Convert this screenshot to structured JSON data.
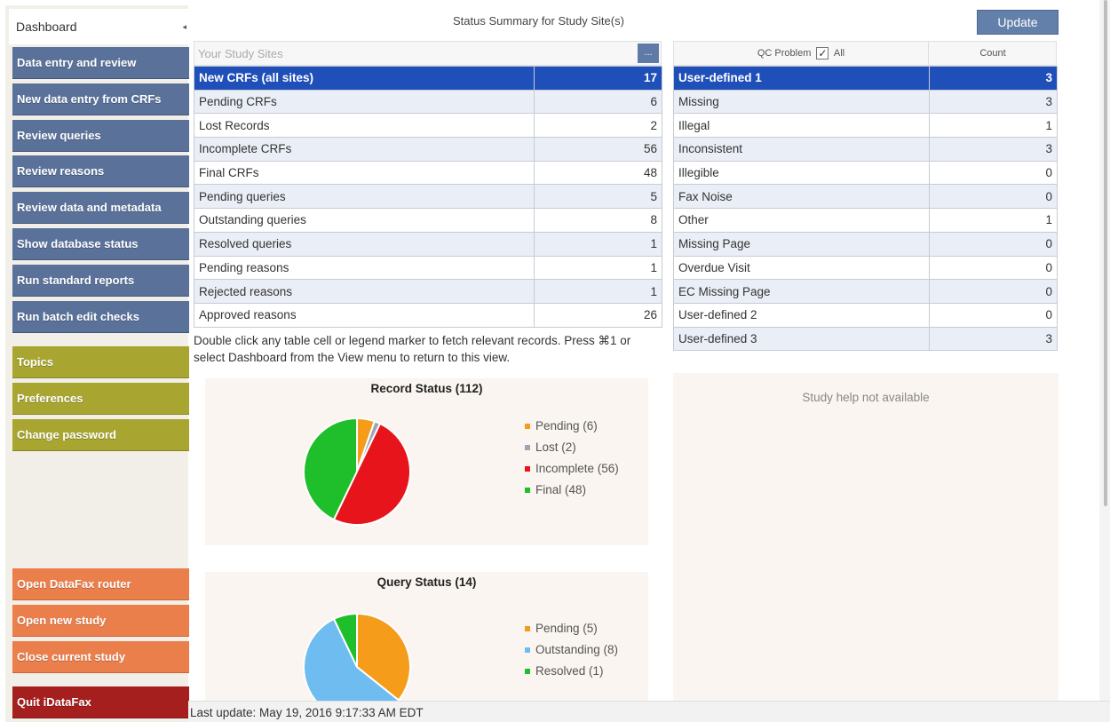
{
  "sidebar": {
    "tab_label": "Dashboard",
    "tab_arrow": "◂",
    "buttons_blue": [
      "Data entry and review",
      "New data entry from CRFs",
      "Review  queries",
      "Review reasons",
      "Review data and metadata",
      "Show database status",
      "Run standard reports",
      "Run batch edit checks"
    ],
    "buttons_olive": [
      "Topics",
      "Preferences",
      "Change password"
    ],
    "buttons_orange": [
      "Open DataFax router",
      "Open new study",
      "Close current study"
    ],
    "quit_label": "Quit iDataFax"
  },
  "header": {
    "title": "Status Summary for Study Site(s)",
    "update_label": "Update"
  },
  "sites": {
    "placeholder": "Your Study Sites",
    "more_label": "...",
    "rows": [
      {
        "label": "New CRFs (all sites)",
        "value": "17"
      },
      {
        "label": "Pending CRFs",
        "value": "6"
      },
      {
        "label": "Lost Records",
        "value": "2"
      },
      {
        "label": "Incomplete CRFs",
        "value": "56"
      },
      {
        "label": "Final CRFs",
        "value": "48"
      },
      {
        "label": "Pending queries",
        "value": "5"
      },
      {
        "label": "Outstanding queries",
        "value": "8"
      },
      {
        "label": "Resolved queries",
        "value": "1"
      },
      {
        "label": "Pending reasons",
        "value": "1"
      },
      {
        "label": "Rejected reasons",
        "value": "1"
      },
      {
        "label": "Approved reasons",
        "value": "26"
      }
    ]
  },
  "hint": "Double click any table cell or legend marker to fetch relevant records. Press ⌘1 or select Dashboard from the View menu to return to this view.",
  "qc": {
    "col1": "QC Problem",
    "all_label": "All",
    "checkmark": "✓",
    "col2": "Count",
    "rows": [
      {
        "label": "User-defined 1",
        "value": "3"
      },
      {
        "label": "Missing",
        "value": "3"
      },
      {
        "label": "Illegal",
        "value": "1"
      },
      {
        "label": "Inconsistent",
        "value": "3"
      },
      {
        "label": "Illegible",
        "value": "0"
      },
      {
        "label": "Fax Noise",
        "value": "0"
      },
      {
        "label": "Other",
        "value": "1"
      },
      {
        "label": "Missing Page",
        "value": "0"
      },
      {
        "label": "Overdue Visit",
        "value": "0"
      },
      {
        "label": "EC Missing Page",
        "value": "0"
      },
      {
        "label": "User-defined 2",
        "value": "0"
      },
      {
        "label": "User-defined 3",
        "value": "3"
      }
    ]
  },
  "chart_data": [
    {
      "type": "pie",
      "title": "Record Status (112)",
      "categories": [
        "Pending (6)",
        "Lost (2)",
        "Incomplete (56)",
        "Final (48)"
      ],
      "values": [
        6,
        2,
        56,
        48
      ],
      "colors": [
        "#f59c1a",
        "#9aa6b8",
        "#e8141c",
        "#1fbf2b"
      ]
    },
    {
      "type": "pie",
      "title": "Query Status (14)",
      "categories": [
        "Pending (5)",
        "Outstanding (8)",
        "Resolved (1)"
      ],
      "values": [
        5,
        8,
        1
      ],
      "colors": [
        "#f59c1a",
        "#6fbdf0",
        "#1fbf2b"
      ]
    }
  ],
  "help": {
    "text": "Study help not available"
  },
  "status": {
    "last_update": "Last update: May 19, 2016 9:17:33 AM EDT"
  }
}
